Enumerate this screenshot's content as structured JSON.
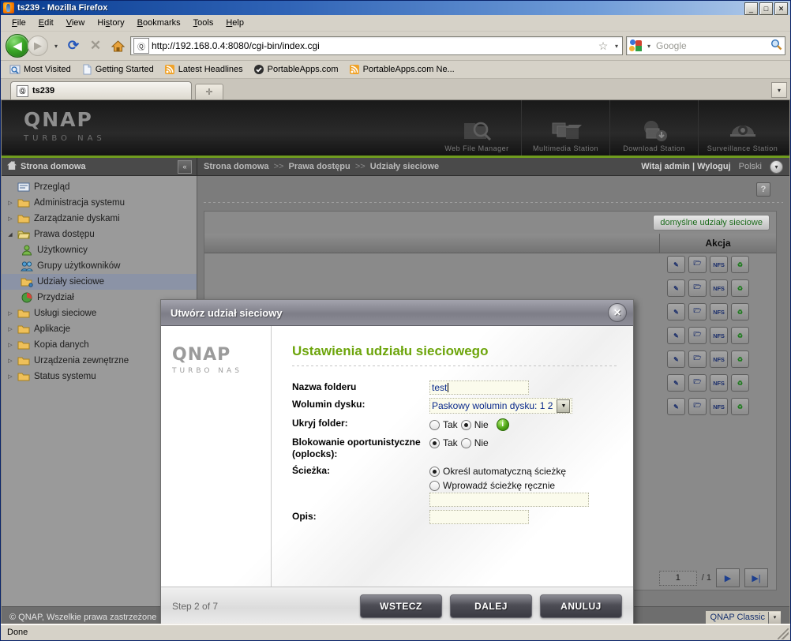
{
  "window": {
    "title": "ts239 - Mozilla Firefox",
    "minimize": "_",
    "maximize": "□",
    "close": "✕"
  },
  "menu": [
    "File",
    "Edit",
    "View",
    "History",
    "Bookmarks",
    "Tools",
    "Help"
  ],
  "toolbar": {
    "back_icon": "◀",
    "forward_icon": "▶",
    "dropdown_icon": "▾",
    "reload_icon": "⟳",
    "stop_icon": "✕",
    "home_icon": "⌂",
    "url": "http://192.168.0.4:8080/cgi-bin/index.cgi",
    "star_icon": "☆",
    "search_placeholder": "Google",
    "search_icon": "🔍"
  },
  "bookmarks": [
    {
      "label": "Most Visited",
      "icon": "most-visited-icon"
    },
    {
      "label": "Getting Started",
      "icon": "page-icon"
    },
    {
      "label": "Latest Headlines",
      "icon": "rss-icon"
    },
    {
      "label": "PortableApps.com",
      "icon": "portableapps-icon"
    },
    {
      "label": "PortableApps.com Ne...",
      "icon": "rss-icon"
    }
  ],
  "tabs": {
    "active_label": "ts239",
    "new_tab_icon": "✛",
    "list_icon": "▾"
  },
  "qnap": {
    "logo": "QNAP",
    "tagline": "TURBO NAS",
    "apps": [
      {
        "label": "Web File Manager"
      },
      {
        "label": "Multimedia Station"
      },
      {
        "label": "Download Station"
      },
      {
        "label": "Surveillance Station"
      }
    ]
  },
  "navrow": {
    "home_label": "Strona domowa",
    "home_icon": "home-icon",
    "collapse_icon": "«",
    "breadcrumb": [
      "Strona domowa",
      "Prawa dostępu",
      "Udziały sieciowe"
    ],
    "breadcrumb_sep": ">>",
    "welcome": "Witaj admin | Wyloguj",
    "language": "Polski",
    "language_arrow": "▾"
  },
  "sidebar": {
    "items": [
      {
        "label": "Przegląd",
        "twisty": "",
        "icon": "overview-icon",
        "indent": false,
        "selected": false
      },
      {
        "label": "Administracja systemu",
        "twisty": "▷",
        "icon": "folder-icon",
        "indent": false,
        "selected": false
      },
      {
        "label": "Zarządzanie dyskami",
        "twisty": "▷",
        "icon": "folder-icon",
        "indent": false,
        "selected": false
      },
      {
        "label": "Prawa dostępu",
        "twisty": "◢",
        "icon": "folder-open-icon",
        "indent": false,
        "selected": false
      },
      {
        "label": "Użytkownicy",
        "twisty": "",
        "icon": "user-icon",
        "indent": true,
        "selected": false
      },
      {
        "label": "Grupy użytkowników",
        "twisty": "",
        "icon": "users-group-icon",
        "indent": true,
        "selected": false
      },
      {
        "label": "Udziały sieciowe",
        "twisty": "",
        "icon": "share-folder-icon",
        "indent": true,
        "selected": true
      },
      {
        "label": "Przydział",
        "twisty": "",
        "icon": "quota-icon",
        "indent": true,
        "selected": false
      },
      {
        "label": "Usługi sieciowe",
        "twisty": "▷",
        "icon": "folder-icon",
        "indent": false,
        "selected": false
      },
      {
        "label": "Aplikacje",
        "twisty": "▷",
        "icon": "folder-icon",
        "indent": false,
        "selected": false
      },
      {
        "label": "Kopia danych",
        "twisty": "▷",
        "icon": "folder-icon",
        "indent": false,
        "selected": false
      },
      {
        "label": "Urządzenia zewnętrzne",
        "twisty": "▷",
        "icon": "folder-icon",
        "indent": false,
        "selected": false
      },
      {
        "label": "Status systemu",
        "twisty": "▷",
        "icon": "folder-icon",
        "indent": false,
        "selected": false
      }
    ]
  },
  "content": {
    "help_icon": "?",
    "restore_button": "domyślne udziały sieciowe",
    "table_header_action": "Akcja",
    "row_count": 7,
    "row_actions": [
      {
        "name": "edit-properties-icon",
        "glyph": "✎"
      },
      {
        "name": "access-permission-icon",
        "glyph": "📂"
      },
      {
        "name": "nfs-icon",
        "glyph": "NFS"
      },
      {
        "name": "refresh-icon",
        "glyph": "♻"
      }
    ],
    "pager": {
      "page_value": "1",
      "total": "/ 1",
      "next_icon": "▶",
      "last_icon": "▶|"
    }
  },
  "page_footer": {
    "copyright": "© QNAP, Wszelkie prawa zastrzeżone",
    "theme": "QNAP Classic",
    "theme_arrow": "▾"
  },
  "statusbar": {
    "text": "Done"
  },
  "dialog": {
    "title": "Utwórz udział sieciowy",
    "close_icon": "✕",
    "brand": "QNAP",
    "brand_sub": "TURBO NAS",
    "heading": "Ustawienia udziału sieciowego",
    "fields": {
      "folder_name_label": "Nazwa folderu",
      "folder_name_value": "test",
      "volume_label": "Wolumin dysku:",
      "volume_value": "Paskowy wolumin dysku: 1 2",
      "volume_arrow": "▼",
      "hide_folder_label": "Ukryj folder:",
      "hide_yes": "Tak",
      "hide_no": "Nie",
      "hide_selected": "Nie",
      "info_icon": "i",
      "oplocks_label": "Blokowanie oportunistyczne (oplocks):",
      "oplocks_yes": "Tak",
      "oplocks_no": "Nie",
      "oplocks_selected": "Tak",
      "path_label": "Ścieżka:",
      "path_auto": "Określ automatyczną ścieżkę",
      "path_manual": "Wprowadź ścieżkę ręcznie",
      "path_selected": "Określ automatyczną ścieżkę",
      "path_value": "",
      "description_label": "Opis:",
      "description_value": ""
    },
    "footer": {
      "step": "Step 2 of 7",
      "back": "WSTECZ",
      "next": "DALEJ",
      "cancel": "ANULUJ"
    }
  },
  "colors": {
    "qnap_green": "#6da50c",
    "title_blue": "#2e62b5",
    "chrome_gray": "#d6d2c8"
  }
}
